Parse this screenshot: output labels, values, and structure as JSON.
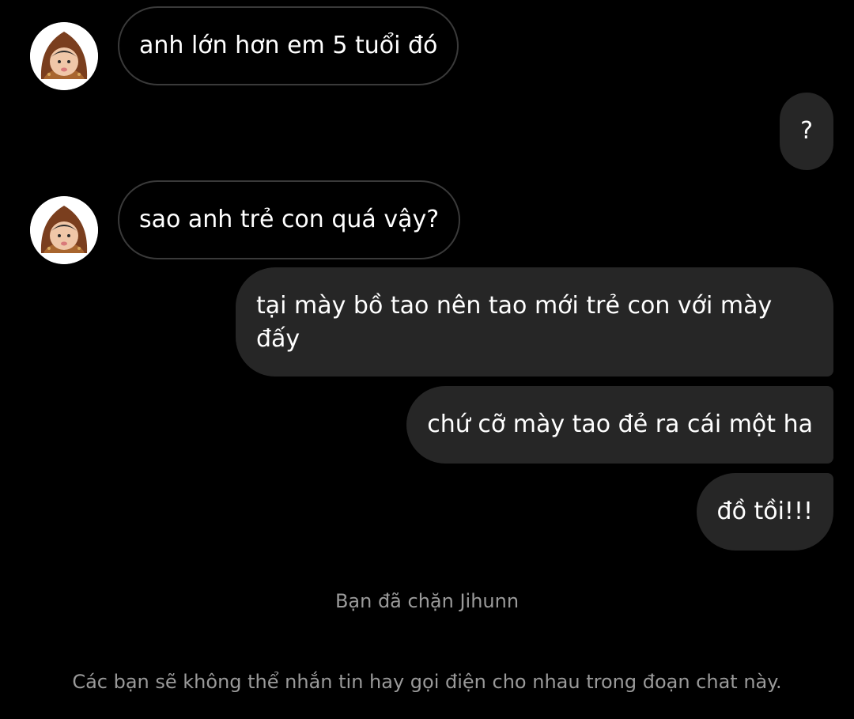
{
  "conversation": {
    "contact_avatar_icon": "contact-avatar-icon",
    "messages": [
      {
        "direction": "incoming",
        "text": "anh lớn hơn em 5 tuổi đó"
      },
      {
        "direction": "outgoing",
        "text": "?"
      },
      {
        "direction": "incoming",
        "text": "sao anh trẻ con quá vậy?"
      },
      {
        "direction": "outgoing",
        "text": "tại mày bồ tao nên tao mới trẻ con với mày đấy"
      },
      {
        "direction": "outgoing",
        "text": "chứ cỡ mày tao đẻ ra cái một ha"
      },
      {
        "direction": "outgoing",
        "text": "đồ tồi!!!"
      }
    ],
    "system_notices": {
      "blocked": "Bạn đã chặn Jihunn",
      "cannot_message": "Các bạn sẽ không thể nhắn tin hay gọi điện cho nhau trong đoạn chat này."
    }
  },
  "colors": {
    "background": "#000000",
    "outgoing_bubble": "#262626",
    "incoming_border": "#3a3a3a",
    "system_text": "#9a9a9a"
  }
}
